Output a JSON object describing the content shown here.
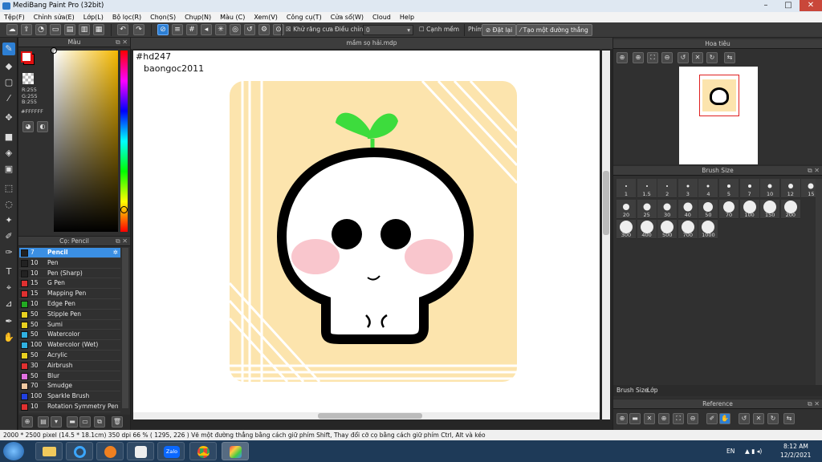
{
  "window": {
    "title": "MediBang Paint Pro (32bit)",
    "minimize": "–",
    "maximize": "□",
    "close": "✕"
  },
  "menu": [
    "Tệp(F)",
    "Chỉnh sửa(E)",
    "Lớp(L)",
    "Bộ lọc(R)",
    "Chọn(S)",
    "Chụp(N)",
    "Màu (C)",
    "Xem(V)",
    "Công cụ(T)",
    "Cửa sổ(W)",
    "Cloud",
    "Help"
  ],
  "toolbar": {
    "antialias_label": "Khử răng cưa",
    "correction_label": "Điều chỉnh",
    "correction_value": "0",
    "edge_label": "Cạnh mềm",
    "key_label": "Phím",
    "reset_label": "Đặt lại",
    "ruler_label": "Tạo một đường thẳng"
  },
  "color_panel": {
    "title": "Màu",
    "r": "R:255",
    "g": "G:255",
    "b": "B:255",
    "hex": "#FFFFFF",
    "primary_color": "#ffffff",
    "secondary_color": "#e01010"
  },
  "brush_panel": {
    "title": "Cọ: Pencil",
    "brushes": [
      {
        "size": "7",
        "name": "Pencil",
        "color": "#222222",
        "selected": true
      },
      {
        "size": "10",
        "name": "Pen",
        "color": "#222222"
      },
      {
        "size": "10",
        "name": "Pen (Sharp)",
        "color": "#222222"
      },
      {
        "size": "15",
        "name": "G Pen",
        "color": "#e03030"
      },
      {
        "size": "15",
        "name": "Mapping Pen",
        "color": "#e03030"
      },
      {
        "size": "10",
        "name": "Edge Pen",
        "color": "#22aa22"
      },
      {
        "size": "50",
        "name": "Stipple Pen",
        "color": "#e8d020"
      },
      {
        "size": "50",
        "name": "Sumi",
        "color": "#e8d020"
      },
      {
        "size": "50",
        "name": "Watercolor",
        "color": "#30b0e0"
      },
      {
        "size": "100",
        "name": "Watercolor (Wet)",
        "color": "#30b0e0"
      },
      {
        "size": "50",
        "name": "Acrylic",
        "color": "#e8d020"
      },
      {
        "size": "30",
        "name": "Airbrush",
        "color": "#e03030"
      },
      {
        "size": "50",
        "name": "Blur",
        "color": "#e070e0"
      },
      {
        "size": "70",
        "name": "Smudge",
        "color": "#f0c8a0"
      },
      {
        "size": "100",
        "name": "Sparkle Brush",
        "color": "#2040e0"
      },
      {
        "size": "10",
        "name": "Rotation Symmetry Pen",
        "color": "#e03030"
      }
    ]
  },
  "document": {
    "tab": "mầm sọ hải.mdp",
    "text1": "#hd247",
    "text2": "baongoc2011"
  },
  "navigator": {
    "title": "Hoa tiêu"
  },
  "brush_size": {
    "title": "Brush Size",
    "sizes": [
      "1",
      "1.5",
      "2",
      "3",
      "4",
      "5",
      "7",
      "10",
      "12",
      "15",
      "20",
      "25",
      "30",
      "40",
      "50",
      "70",
      "100",
      "150",
      "200",
      "300",
      "400",
      "500",
      "700",
      "1000"
    ],
    "tabs": [
      "Brush Size",
      "Lớp"
    ]
  },
  "reference": {
    "title": "Reference"
  },
  "status": "2000 * 2500 pixel   (14.5 * 18.1cm)   350 dpi   66 %   ( 1295, 226 )   Vẽ một đường thẳng bằng cách giữ phím Shift, Thay đổi cỡ cọ bằng cách giữ phím Ctrl, Alt và kéo",
  "taskbar": {
    "zalo_label": "Zalo",
    "lang": "EN",
    "time": "8:12 AM",
    "date": "12/2/2021"
  }
}
